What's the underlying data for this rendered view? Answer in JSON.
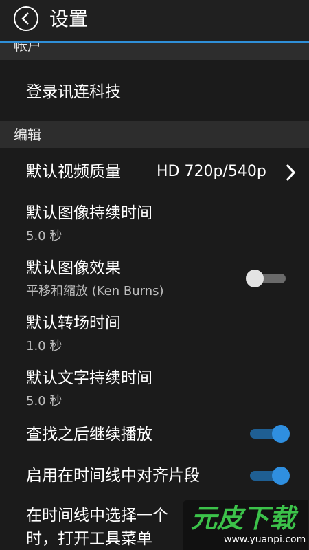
{
  "header": {
    "title": "设置",
    "back_icon": "back-arrow-icon"
  },
  "colors": {
    "accent": "#2f8fd8",
    "toggle_on": "#2f8fe0",
    "watermark": "#3cc24a"
  },
  "sections": {
    "account": {
      "label": "帐户",
      "login_label": "登录讯连科技"
    },
    "edit": {
      "label": "编辑",
      "video_quality": {
        "label": "默认视频质量",
        "value": "HD 720p/540p",
        "icon": "chevron-right-icon"
      },
      "image_duration": {
        "label": "默认图像持续时间",
        "value": "5.0 秒"
      },
      "image_effect": {
        "label": "默认图像效果",
        "value": "平移和缩放 (Ken Burns)",
        "enabled": false
      },
      "transition_duration": {
        "label": "默认转场时间",
        "value": "1.0 秒"
      },
      "text_duration": {
        "label": "默认文字持续时间",
        "value": "5.0 秒"
      },
      "continue_after_seek": {
        "label": "查找之后继续播放",
        "enabled": true
      },
      "snap_timeline": {
        "label": "启用在时间线中对齐片段",
        "enabled": true
      },
      "open_toolbar": {
        "line1": "在时间线中选择一个",
        "line2": "时，打开工具菜单"
      }
    }
  },
  "watermark": {
    "brand": "元皮下载",
    "url": "www.yuanpi.com"
  }
}
